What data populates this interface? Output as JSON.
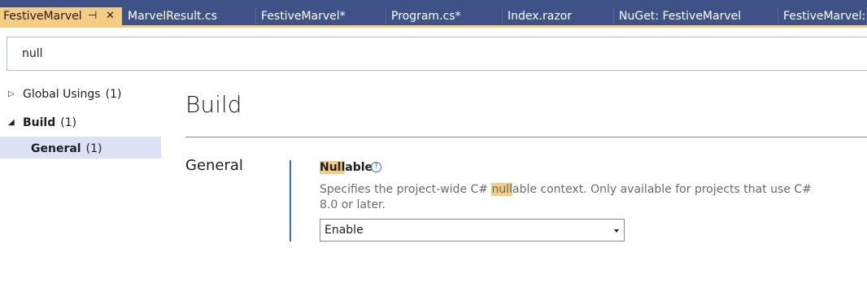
{
  "tabs": [
    {
      "label": "FestiveMarvel",
      "active": true
    },
    {
      "label": "MarvelResult.cs"
    },
    {
      "label": "FestiveMarvel*"
    },
    {
      "label": "Program.cs*"
    },
    {
      "label": "Index.razor"
    },
    {
      "label": "NuGet: FestiveMarvel"
    },
    {
      "label": "FestiveMarvel: C"
    }
  ],
  "icons": {
    "pin": "pin-icon",
    "close": "close-icon",
    "expand": "triangle-right-icon",
    "collapse": "triangle-down-icon",
    "help": "question-circle-icon",
    "dropdown": "chevron-down-icon"
  },
  "search": {
    "value": "null"
  },
  "tree": {
    "items": [
      {
        "label": "Global Usings",
        "count": "(1)"
      },
      {
        "label": "Build",
        "count": "(1)"
      },
      {
        "label": "General",
        "count": "(1)",
        "selected": true
      }
    ]
  },
  "main": {
    "heading": "Build",
    "section": "General",
    "setting": {
      "name_highlight": "Null",
      "name_rest": "able",
      "desc_before": "Specifies the project-wide C# ",
      "desc_highlight": "null",
      "desc_after": "able context. Only available for projects that use C# 8.0 or later.",
      "value": "Enable"
    }
  },
  "colors": {
    "tab_bar": "#3e5288",
    "active_tab": "#f5cc84",
    "highlight": "#f5cc84",
    "accent": "#2e6fd1",
    "selection": "#dce2f3"
  }
}
